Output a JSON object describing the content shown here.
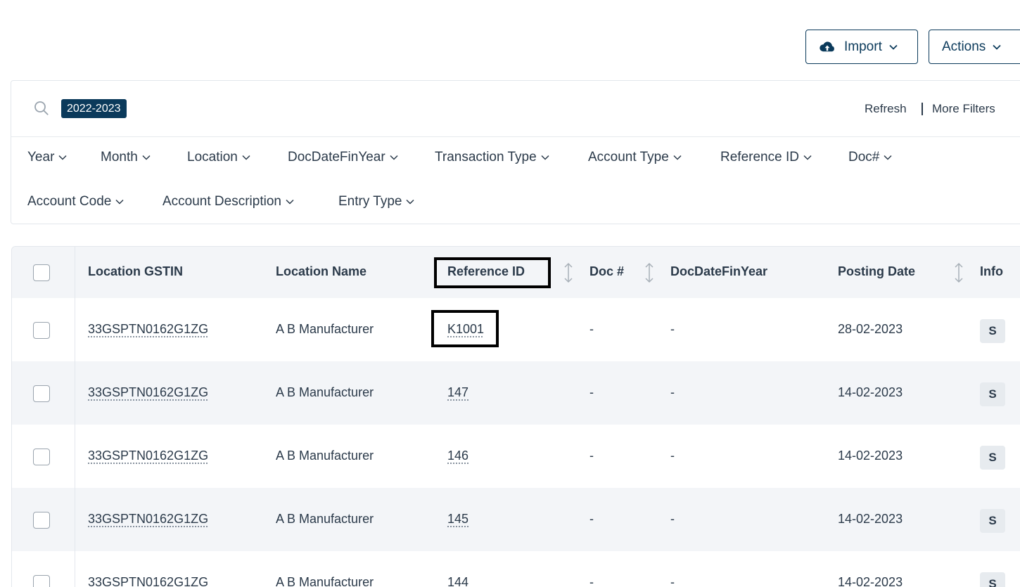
{
  "toolbar": {
    "import_label": "Import",
    "actions_label": "Actions"
  },
  "filters": {
    "active_chip": "2022-2023",
    "refresh_label": "Refresh",
    "more_filters_label": "More Filters",
    "items": [
      "Year",
      "Month",
      "Location",
      "DocDateFinYear",
      "Transaction Type",
      "Account Type",
      "Reference ID",
      "Doc#",
      "Account Code",
      "Account Description",
      "Entry Type"
    ]
  },
  "table": {
    "columns": [
      "Location GSTIN",
      "Location Name",
      "Reference ID",
      "Doc #",
      "DocDateFinYear",
      "Posting Date",
      "Info"
    ],
    "rows": [
      {
        "gstin": "33GSPTN0162G1ZG",
        "name": "A B Manufacturer",
        "ref": "K1001",
        "doc": "-",
        "fin": "-",
        "date": "28-02-2023",
        "info": "S"
      },
      {
        "gstin": "33GSPTN0162G1ZG",
        "name": "A B Manufacturer",
        "ref": "147",
        "doc": "-",
        "fin": "-",
        "date": "14-02-2023",
        "info": "S"
      },
      {
        "gstin": "33GSPTN0162G1ZG",
        "name": "A B Manufacturer",
        "ref": "146",
        "doc": "-",
        "fin": "-",
        "date": "14-02-2023",
        "info": "S"
      },
      {
        "gstin": "33GSPTN0162G1ZG",
        "name": "A B Manufacturer",
        "ref": "145",
        "doc": "-",
        "fin": "-",
        "date": "14-02-2023",
        "info": "S"
      },
      {
        "gstin": "33GSPTN0162G1ZG",
        "name": "A B Manufacturer",
        "ref": "144",
        "doc": "-",
        "fin": "-",
        "date": "14-02-2023",
        "info": "S"
      }
    ]
  },
  "colors": {
    "accent": "#0b3a5b",
    "header_bg": "#f3f5f8",
    "text": "#2b3a4a"
  }
}
